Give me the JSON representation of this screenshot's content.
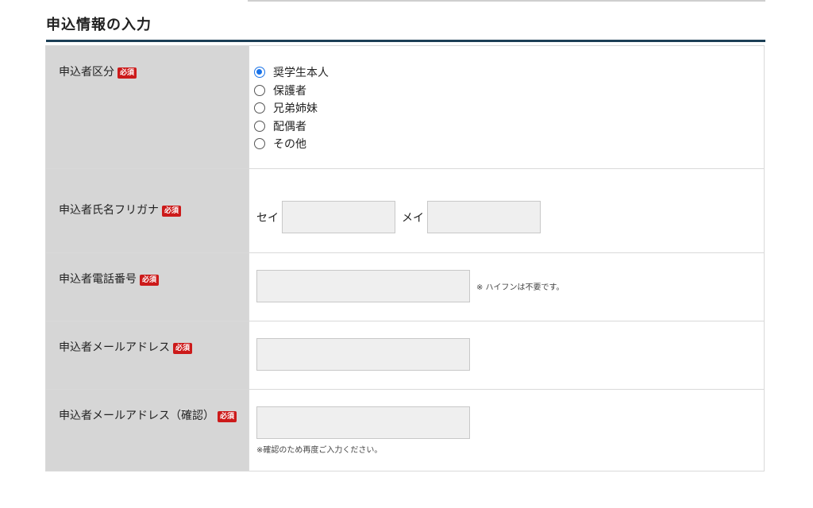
{
  "section_title": "申込情報の入力",
  "required_badge": "必須",
  "applicant_type": {
    "label": "申込者区分",
    "options": [
      "奨学生本人",
      "保護者",
      "兄弟姉妹",
      "配偶者",
      "その他"
    ],
    "selected": "奨学生本人"
  },
  "furigana": {
    "label": "申込者氏名フリガナ",
    "sei_label": "セイ",
    "mei_label": "メイ",
    "sei_value": "",
    "mei_value": ""
  },
  "phone": {
    "label": "申込者電話番号",
    "value": "",
    "note": "※ ハイフンは不要です。"
  },
  "email": {
    "label": "申込者メールアドレス",
    "value": ""
  },
  "email_confirm": {
    "label": "申込者メールアドレス（確認）",
    "value": "",
    "note": "※確認のため再度ご入力ください。"
  },
  "colors": {
    "heading_rule": "#1c3f56",
    "required_badge_bg": "#cc1a1a",
    "label_cell_bg": "#d6d6d6",
    "input_bg": "#efefef",
    "radio_selected": "#1a73e8"
  }
}
